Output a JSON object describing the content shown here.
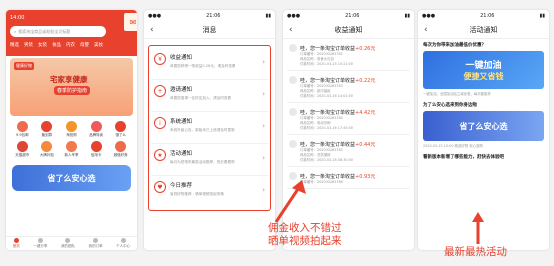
{
  "phone1": {
    "status_time": "14:00",
    "search_placeholder": "搜索淘宝商品或粘贴宝贝标题",
    "categories": [
      "精选",
      "男装",
      "女装",
      "食品",
      "内衣",
      "母婴",
      "美妆"
    ],
    "banner_title": "宅家享健康",
    "banner_sub": "春季防护指南",
    "banner_tag": "健康好物",
    "grid": [
      {
        "label": "9.9包邮",
        "color": "#f06a4f"
      },
      {
        "label": "聚划算",
        "color": "#e8412e"
      },
      {
        "label": "淘抢购",
        "color": "#f1962c"
      },
      {
        "label": "品牌特卖",
        "color": "#ef5b5b"
      },
      {
        "label": "饿了么",
        "color": "#e8412e"
      },
      {
        "label": "天猫超市",
        "color": "#e14533"
      },
      {
        "label": "大牌补贴",
        "color": "#f48a3c"
      },
      {
        "label": "新人专享",
        "color": "#f07a4e"
      },
      {
        "label": "信用卡",
        "color": "#e8412e"
      },
      {
        "label": "超值好券",
        "color": "#ef6a4a"
      }
    ],
    "promo_text": "省了么安心选",
    "tabs": [
      "首页",
      "一键分享",
      "我的团队",
      "我的订单",
      "个人中心"
    ]
  },
  "phone2": {
    "status_time": "21:06",
    "title": "消息",
    "items": [
      {
        "title": "收益通知",
        "desc": "恭喜您获得一笔收益0.26元，请及时查看",
        "icon": "¥"
      },
      {
        "title": "邀请通知",
        "desc": "恭喜您邀请一名好友加入，请及时查看",
        "icon": "+"
      },
      {
        "title": "系统通知",
        "desc": "系统升级公告，新版本已上线请及时更新",
        "icon": "i"
      },
      {
        "title": "活动通知",
        "desc": "每月为您带来最惠活动推荐，快去看看吧",
        "icon": "★"
      },
      {
        "title": "今日推荐",
        "desc": "省钱好物推荐 - 晒单视频拍起来哦",
        "icon": "♥"
      }
    ]
  },
  "phone3": {
    "status_time": "21:06",
    "title": "收益通知",
    "cards": [
      {
        "head": "哇，您一条淘宝订单收益",
        "amount": "+0.26元",
        "lines": [
          "订单编号：202003265782",
          "商品名称：零食大礼包",
          "付款时间：2020-03-15 10:21:00"
        ]
      },
      {
        "head": "哇，您一条淘宝订单收益",
        "amount": "+0.22元",
        "lines": [
          "订单编号：202003265783",
          "商品名称：纸巾抽纸",
          "付款时间：2020-03-16 14:01:00"
        ]
      },
      {
        "head": "哇，您一条淘宝订单收益",
        "amount": "+4.42元",
        "lines": [
          "订单编号：202003265784",
          "商品名称：电动牙刷",
          "付款时间：2020-03-16 17:45:00"
        ]
      },
      {
        "head": "哇，您一条淘宝订单收益",
        "amount": "+0.44元",
        "lines": [
          "订单编号：202003265785",
          "商品名称：洗衣凝珠",
          "付款时间：2020-03-18 08:30:00"
        ]
      },
      {
        "head": "哇，您一条淘宝订单收益",
        "amount": "+0.93元",
        "lines": [
          "订单编号：202003265786",
          "商品名称：保温杯",
          "付款时间：2020-03-20 19:12:00"
        ]
      }
    ]
  },
  "phone4": {
    "status_time": "21:06",
    "title": "活动通知",
    "sec1_title": "每次为你带来加油最低价优惠？",
    "img1_line1": "一键加油",
    "img1_line2": "便捷又省钱",
    "sec1_meta": "一键加油，全国加油站立减优惠，每天都能享",
    "sec2_title": "为了么安心选来到你身边啦",
    "img2_text": "省了么安心选",
    "sec2_meta": "2020-03-15 10:00  精选好物 安心选购",
    "sec3_title": "看新版本新增了哪些能力，赶快去体验吧"
  },
  "captions": {
    "left_line1": "佣金收入不错过",
    "left_line2": "晒单视频拍起来",
    "right": "最新最热活动"
  }
}
